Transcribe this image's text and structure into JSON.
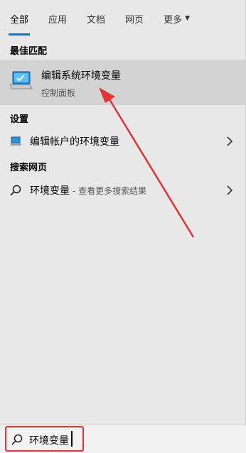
{
  "tabs": [
    {
      "label": "全部"
    },
    {
      "label": "应用"
    },
    {
      "label": "文档"
    },
    {
      "label": "网页"
    },
    {
      "label": "更多"
    }
  ],
  "sections": {
    "best_match": "最佳匹配",
    "settings": "设置",
    "web_search": "搜索网页"
  },
  "best_match_item": {
    "title": "编辑系统环境变量",
    "subtitle": "控制面板"
  },
  "settings_item": {
    "label": "编辑帐户的环境变量"
  },
  "web_item": {
    "label": "环境变量",
    "suffix": " - 查看更多搜索结果"
  },
  "search": {
    "value": "环境变量"
  },
  "colors": {
    "accent": "#0078d7",
    "annotation": "#e53333"
  }
}
